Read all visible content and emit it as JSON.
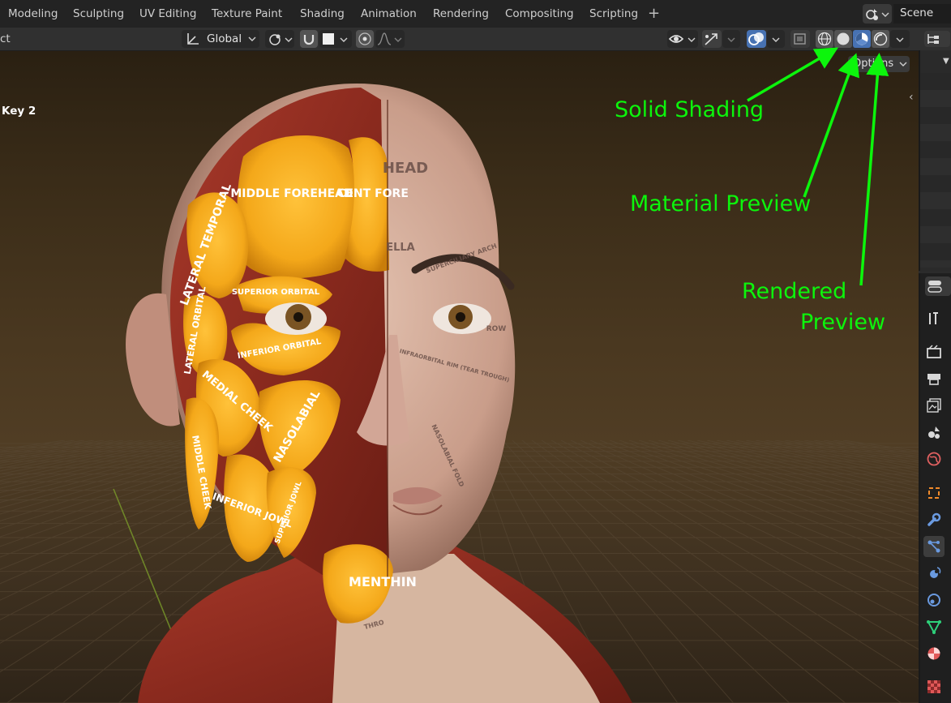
{
  "workspace_tabs": [
    "Modeling",
    "Sculpting",
    "UV Editing",
    "Texture Paint",
    "Shading",
    "Animation",
    "Rendering",
    "Compositing",
    "Scripting"
  ],
  "add_workspace": "+",
  "scene": {
    "icon": "scene-icon",
    "name": "Scene"
  },
  "header": {
    "left_cut_text": "ct",
    "orientation_label": "Global",
    "pivot_icon": "pivot-icon",
    "snap_icon": "magnet-icon",
    "proportional_icon": "proportional-icon",
    "visibility_icon": "eye-icon",
    "gizmo_icon": "gizmo-icon",
    "overlay_icon": "overlay-icon",
    "xray_icon": "xray-icon",
    "shading_modes": [
      "wireframe",
      "solid",
      "material-preview",
      "rendered"
    ],
    "active_shading": "material-preview",
    "options_label": "Options"
  },
  "viewport": {
    "overlay_text": "Key 2",
    "face_labels": [
      "MIDDLE FOREHEAD",
      "CENT FORE",
      "LATERAL TEMPORAL",
      "SUPERIOR ORBITAL",
      "INFERIOR ORBITAL",
      "LATERAL ORBITAL",
      "MEDIAL CHEEK",
      "NASOLABIAL",
      "MIDDLE CHEEK",
      "INFERIOR JOWL",
      "SUPERIOR JOWL",
      "MENTHIN",
      "HEAD",
      "ELLA",
      "SUPERCILIARY ARCH",
      "INFRAORBITAL RIM (TEAR TROUGH)",
      "NASOLABIAL FOLD",
      "ROW",
      "THRO"
    ]
  },
  "annotations": [
    {
      "text": "Solid Shading"
    },
    {
      "text": "Material Preview"
    },
    {
      "text": "Rendered"
    },
    {
      "text": "Preview"
    }
  ],
  "colors": {
    "annotation": "#0cf50c",
    "active_button": "#4772b3"
  },
  "properties_tabs": [
    "tool",
    "render",
    "output",
    "view-layer",
    "scene",
    "world",
    "object",
    "modifiers",
    "particles",
    "physics",
    "constraints",
    "data",
    "material",
    "texture"
  ],
  "active_properties_tab": "particles"
}
